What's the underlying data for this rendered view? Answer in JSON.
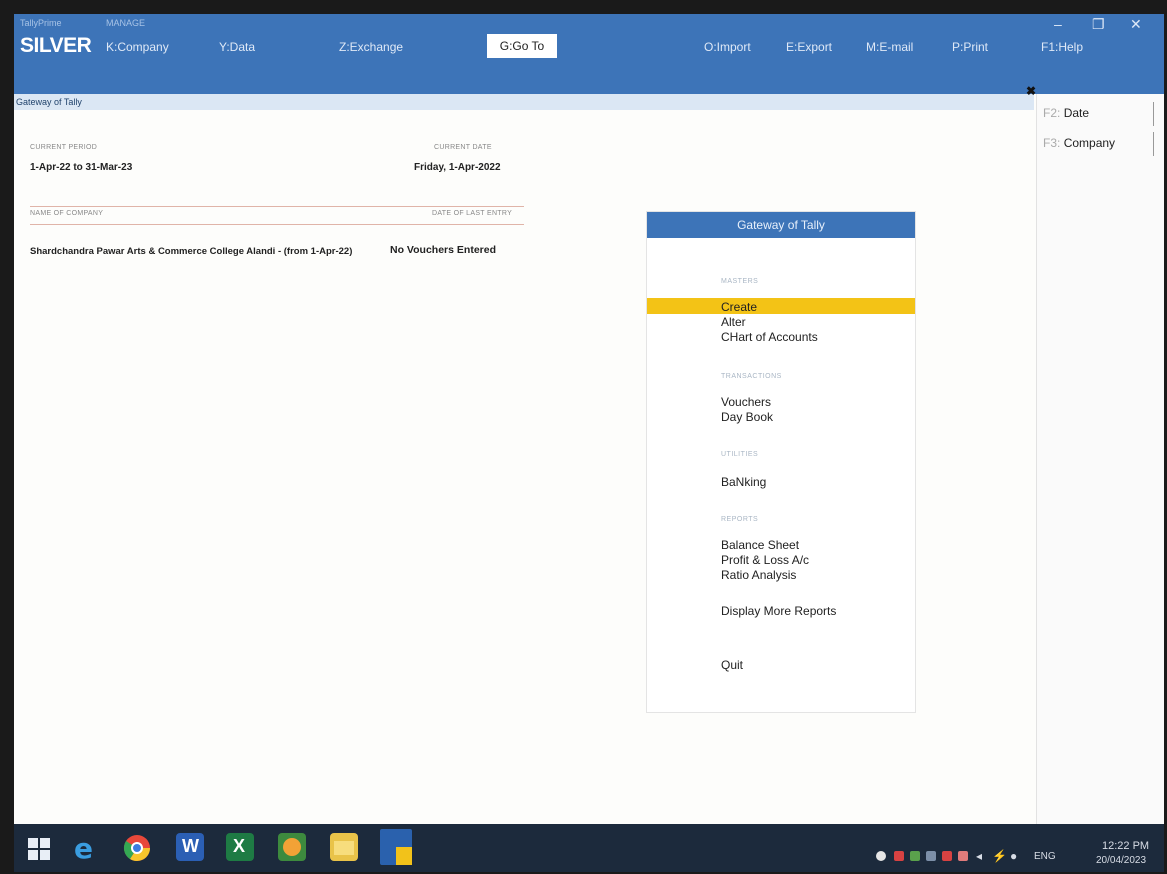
{
  "app": {
    "brand_top_left": "TallyPrime",
    "brand_top_right": "MANAGE",
    "edition": "SILVER",
    "subtitle": "Gateway of Tally"
  },
  "menu": [
    {
      "label": "K:Company"
    },
    {
      "label": "Y:Data"
    },
    {
      "label": "Z:Exchange"
    },
    {
      "label": "G:Go To"
    },
    {
      "label": "O:Import"
    },
    {
      "label": "E:Export"
    },
    {
      "label": "M:E-mail"
    },
    {
      "label": "P:Print"
    },
    {
      "label": "F1:Help"
    }
  ],
  "window_controls": {
    "minimize": "–",
    "restore": "❐",
    "close": "✕"
  },
  "right_panel": {
    "buttons": [
      {
        "key": "F2:",
        "label": "Date"
      },
      {
        "key": "F3:",
        "label": "Company"
      }
    ]
  },
  "info": {
    "current_period_label": "CURRENT PERIOD",
    "current_period_value": "1-Apr-22 to 31-Mar-23",
    "current_date_label": "CURRENT DATE",
    "current_date_value": "Friday, 1-Apr-2022",
    "company_name_label": "NAME OF COMPANY",
    "last_entry_label": "DATE OF LAST ENTRY",
    "company_name": "Shardchandra Pawar Arts & Commerce College Alandi - (from 1-Apr-22)",
    "last_entry": "No Vouchers Entered"
  },
  "gateway": {
    "title": "Gateway of Tally",
    "sections": [
      {
        "label": "MASTERS",
        "items": [
          "Create",
          "Alter",
          "CHart of Accounts"
        ]
      },
      {
        "label": "TRANSACTIONS",
        "items": [
          "Vouchers",
          "Day Book"
        ]
      },
      {
        "label": "UTILITIES",
        "items": [
          "BaNking"
        ]
      },
      {
        "label": "REPORTS",
        "items": [
          "Balance Sheet",
          "Profit & Loss A/c",
          "Ratio Analysis",
          "Display More Reports"
        ]
      }
    ],
    "quit": "Quit",
    "selected": "Create"
  },
  "taskbar": {
    "language": "ENG",
    "time": "12:22 PM",
    "date": "20/04/2023"
  }
}
